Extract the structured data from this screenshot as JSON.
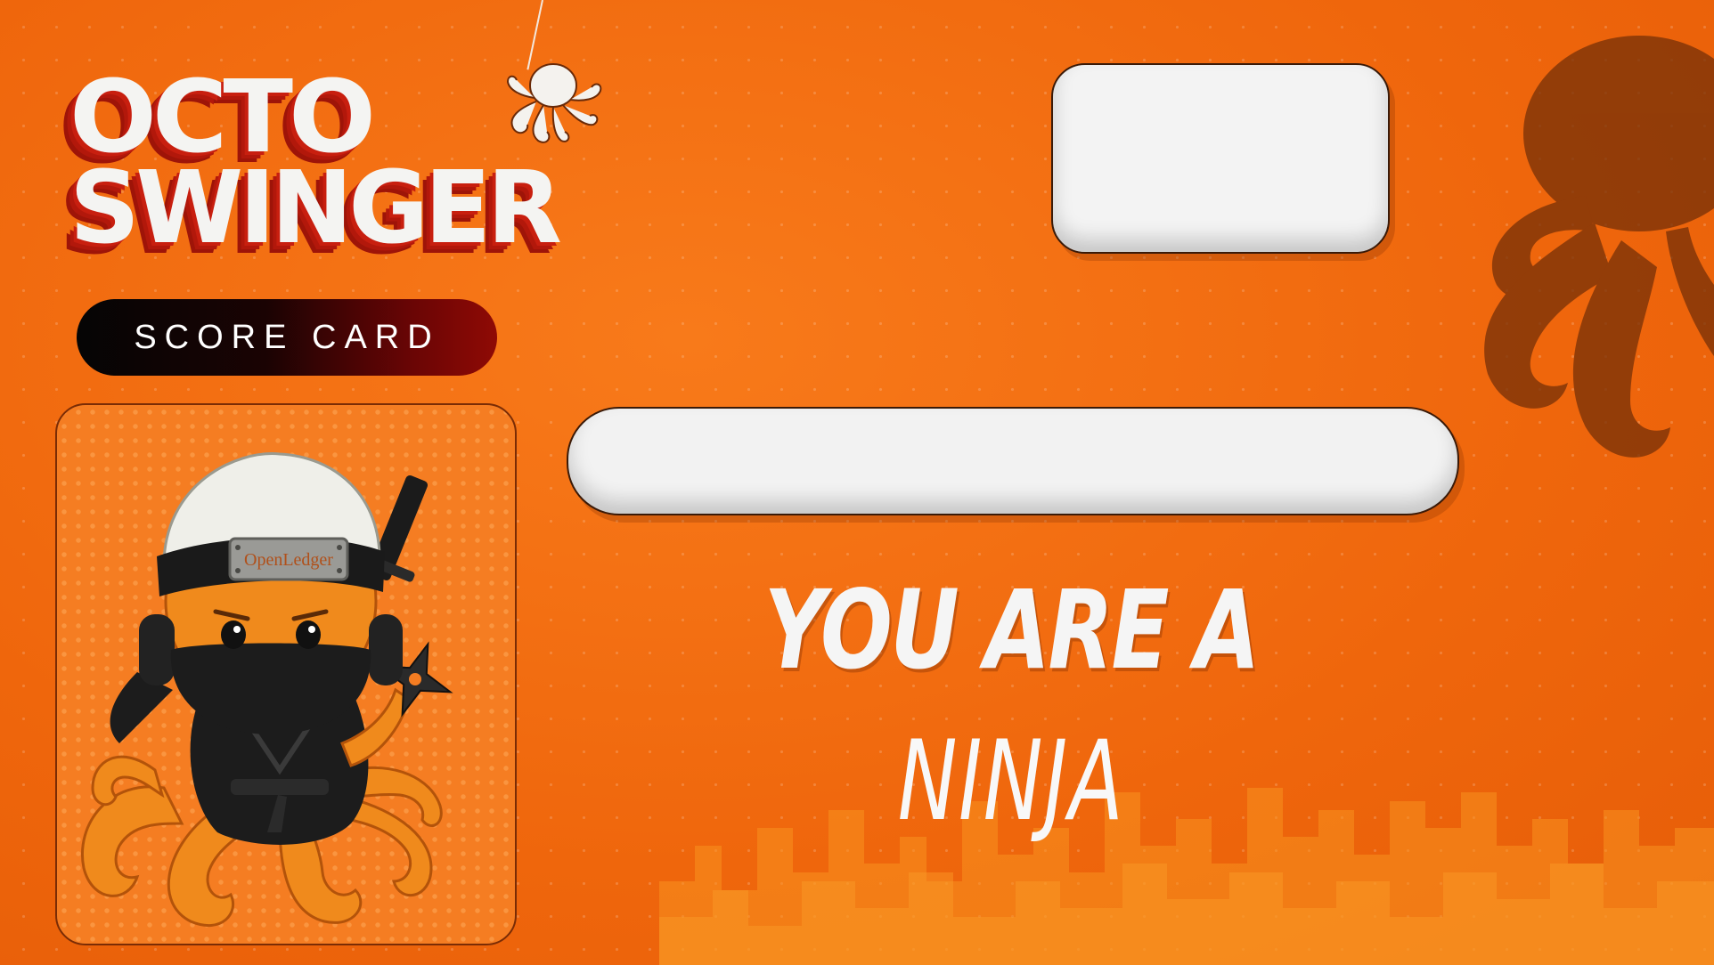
{
  "title": {
    "line1": "OCTO",
    "line2": "SWINGER"
  },
  "badge": {
    "label": "SCORE CARD"
  },
  "avatar": {
    "headband_text": "OpenLedger"
  },
  "result": {
    "prefix": "YOU ARE A",
    "rank": "NINJA"
  },
  "colors": {
    "background": "#f36b10",
    "title_fill": "#f4f4f2",
    "title_shadow": "#c81f0f",
    "badge_start": "#050505",
    "badge_end": "#8f0a05",
    "panel_fill": "#f3f3f3"
  },
  "icons": {
    "title_decor": "octopus-hanging-icon",
    "side_decor": "octopus-silhouette-icon",
    "weapon": "shuriken-icon"
  }
}
